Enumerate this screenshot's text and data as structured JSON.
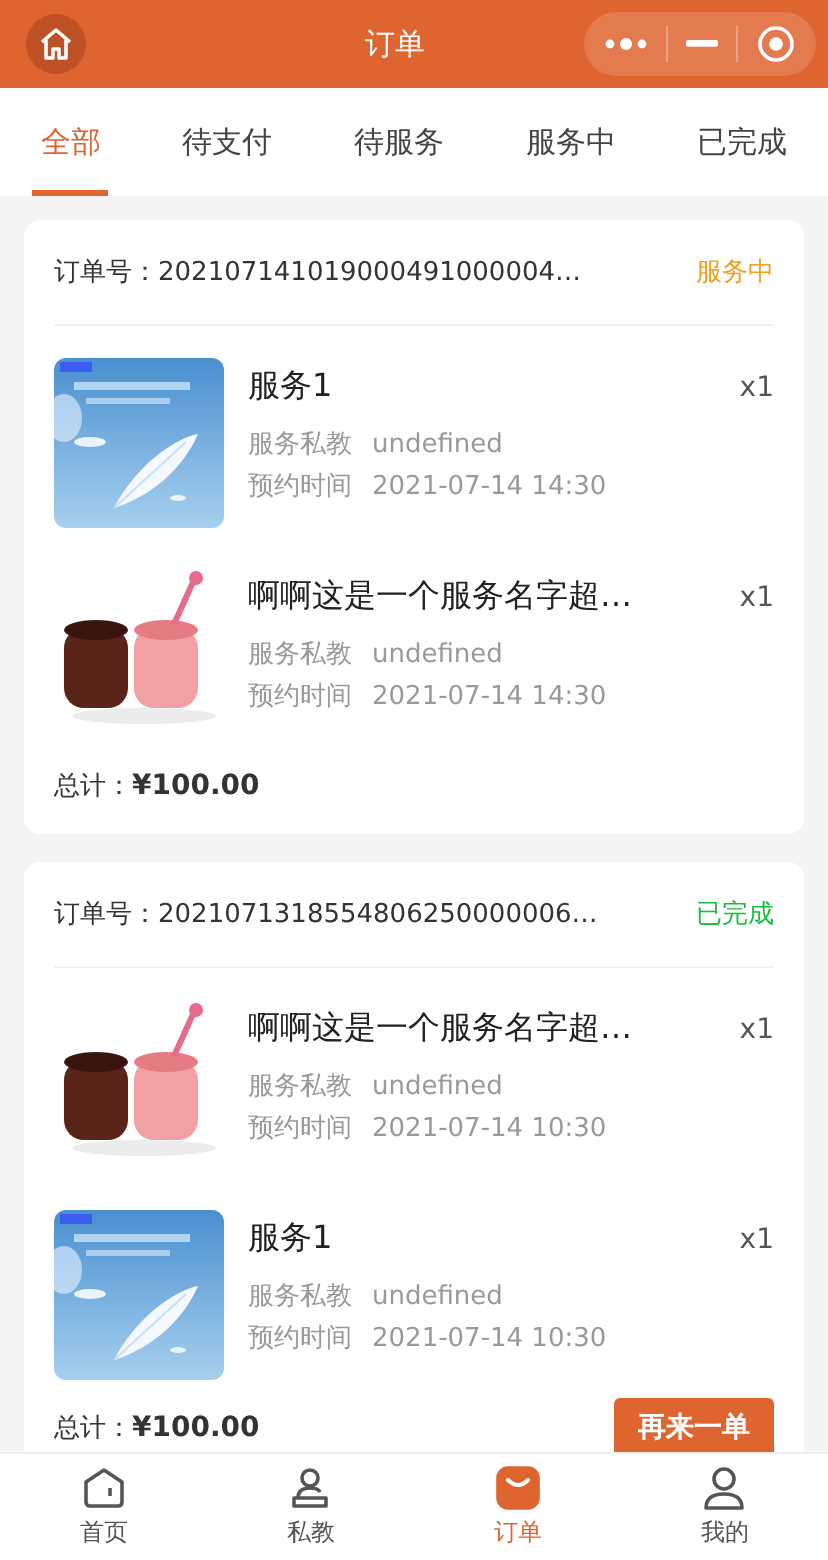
{
  "header": {
    "title": "订单"
  },
  "tabs": [
    {
      "label": "全部",
      "selected": true
    },
    {
      "label": "待支付",
      "selected": false
    },
    {
      "label": "待服务",
      "selected": false
    },
    {
      "label": "服务中",
      "selected": false
    },
    {
      "label": "已完成",
      "selected": false
    }
  ],
  "orders": [
    {
      "order_label": "订单号：",
      "order_no": "202107141019000491000004…",
      "status": "服务中",
      "color": "#f0a020",
      "items": [
        {
          "kind": "picture",
          "name": "服务1",
          "qty": "x1",
          "coach_label": "服务私教",
          "coach": "undefined",
          "time_label": "预约时间",
          "time": "2021-07-14 14:30"
        },
        {
          "kind": "picture",
          "name": "啊啊这是一个服务名字超…",
          "qty": "x1",
          "coach_label": "服务私教",
          "coach": "undefined",
          "time_label": "预约时间",
          "time": "2021-07-14 14:30"
        }
      ],
      "total_label": "总计：",
      "total": "¥100.00"
    },
    {
      "order_label": "订单号：",
      "order_no": "2021071318554806250000006…",
      "status": "已完成",
      "color": "#19be3c",
      "items": [
        {
          "kind": "picture",
          "name": "啊啊这是一个服务名字超…",
          "qty": "x1",
          "coach_label": "服务私教",
          "coach": "undefined",
          "time_label": "预约时间",
          "time": "2021-07-14 10:30"
        },
        {
          "kind": "picture",
          "name": "服务1",
          "qty": "x1",
          "coach_label": "服务私教",
          "coach": "undefined",
          "time_label": "预约时间",
          "time": "2021-07-14 10:30"
        }
      ],
      "total_label": "总计：",
      "total": "¥100.00",
      "action": "再来一单"
    }
  ],
  "bottom_nav": [
    {
      "label": "首页",
      "selected": false
    },
    {
      "label": "私教",
      "selected": false
    },
    {
      "label": "订单",
      "selected": true
    },
    {
      "label": "我的",
      "selected": false
    }
  ]
}
